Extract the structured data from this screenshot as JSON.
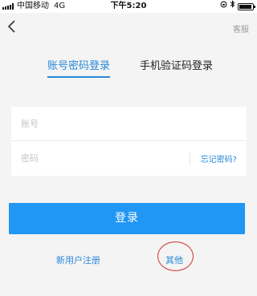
{
  "status_bar": {
    "carrier": "中国移动",
    "network": "4G",
    "time": "下午5:20",
    "icons": [
      "orientation-lock-icon",
      "bluetooth-icon",
      "battery-icon"
    ]
  },
  "nav": {
    "back_icon": "chevron-left-icon",
    "service_label": "客服"
  },
  "tabs": [
    {
      "label": "账号密码登录",
      "active": true
    },
    {
      "label": "手机验证码登录",
      "active": false
    }
  ],
  "form": {
    "account_placeholder": "账号",
    "account_value": "",
    "password_placeholder": "密码",
    "password_value": "",
    "forgot_label": "忘记密码?"
  },
  "login_button": "登录",
  "footer": {
    "register_label": "新用户注册",
    "other_label": "其他"
  },
  "colors": {
    "accent": "#2196f3",
    "link": "#2a88d8",
    "annotation_circle": "#d0322c",
    "background": "#f4f4f4"
  }
}
